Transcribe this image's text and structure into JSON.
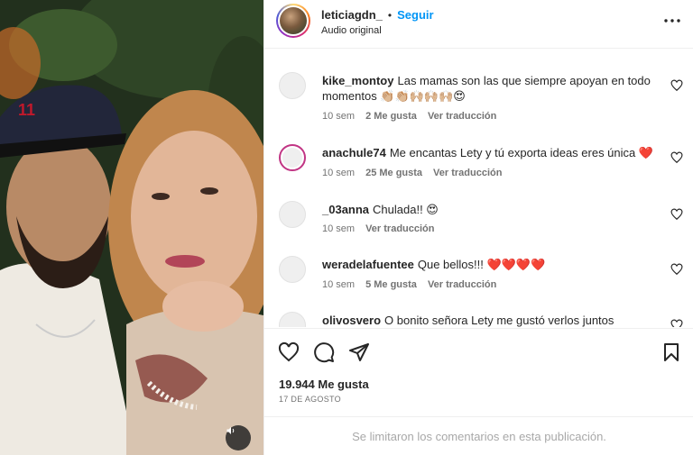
{
  "post": {
    "username": "leticiagdn_",
    "separator": "•",
    "follow_label": "Seguir",
    "audio_label": "Audio original",
    "likes": "19.944 Me gusta",
    "date": "17 DE AGOSTO",
    "comments_limited": "Se limitaron los comentarios en esta publicación."
  },
  "icons": {
    "more": "more-horizontal-icon",
    "like": "heart-outline-icon",
    "comment": "comment-bubble-icon",
    "share": "paper-plane-icon",
    "save": "bookmark-icon",
    "audio": "speaker-icon"
  },
  "colors": {
    "accent": "#0095f6",
    "heart_emoji": "#e0245e"
  },
  "comments": [
    {
      "user": "kike_montoy",
      "text": "Las mamas son las que siempre apoyan en todo momentos 👏🏼👏🏼🙌🏼🙌🏼🙌🏼😍",
      "time": "10 sem",
      "likes": "2 Me gusta",
      "translate": "Ver traducción"
    },
    {
      "user": "anachule74",
      "text": "Me encantas Lety y tú exporta ideas eres única ❤️",
      "time": "10 sem",
      "likes": "25 Me gusta",
      "translate": "Ver traducción"
    },
    {
      "user": "_03anna",
      "text": "Chulada!! 😍",
      "time": "10 sem",
      "likes": "",
      "translate": "Ver traducción"
    },
    {
      "user": "weradelafuentee",
      "text": "Que bellos!!! ❤️❤️❤️❤️",
      "time": "10 sem",
      "likes": "5 Me gusta",
      "translate": "Ver traducción"
    },
    {
      "user": "olivosvero",
      "text": "O bonito señora Lety me gustó verlos juntos",
      "time": "",
      "likes": "",
      "translate": ""
    }
  ]
}
